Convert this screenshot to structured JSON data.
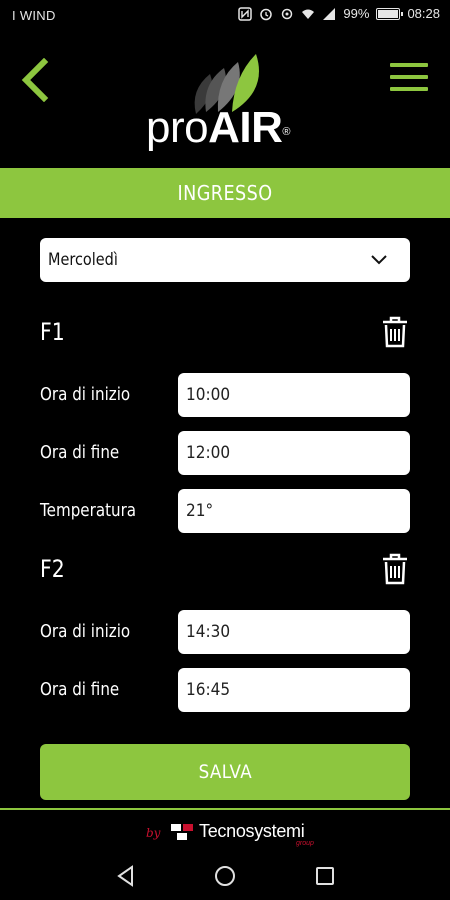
{
  "status_bar": {
    "carrier": "I WIND",
    "battery": "99%",
    "time": "08:28",
    "icons": [
      "nfc-icon",
      "alarm-icon",
      "notification-icon",
      "wifi-icon",
      "signal-icon",
      "battery-icon"
    ]
  },
  "header": {
    "back_icon": "chevron-left-icon",
    "menu_icon": "hamburger-menu-icon",
    "logo": {
      "pro": "pro",
      "air": "AIR",
      "registered": "®"
    }
  },
  "section": {
    "title": "INGRESSO"
  },
  "day_select": {
    "value": "Mercoledì"
  },
  "groups": [
    {
      "title": "F1",
      "rows": [
        {
          "label": "Ora di inizio",
          "value": "10:00"
        },
        {
          "label": "Ora di fine",
          "value": "12:00"
        },
        {
          "label": "Temperatura",
          "value": "21°"
        }
      ]
    },
    {
      "title": "F2",
      "rows": [
        {
          "label": "Ora di inizio",
          "value": "14:30"
        },
        {
          "label": "Ora di fine",
          "value": "16:45"
        }
      ]
    }
  ],
  "save_button": {
    "label": "SALVA"
  },
  "footer": {
    "by": "by",
    "brand": "Tecnosystemi",
    "group": "group"
  },
  "nav": {
    "icons": [
      "back-triangle-icon",
      "home-circle-icon",
      "recents-square-icon"
    ]
  },
  "colors": {
    "accent": "#8dc63f",
    "background": "#000000",
    "field": "#ffffff",
    "brand_red": "#c8102e"
  }
}
